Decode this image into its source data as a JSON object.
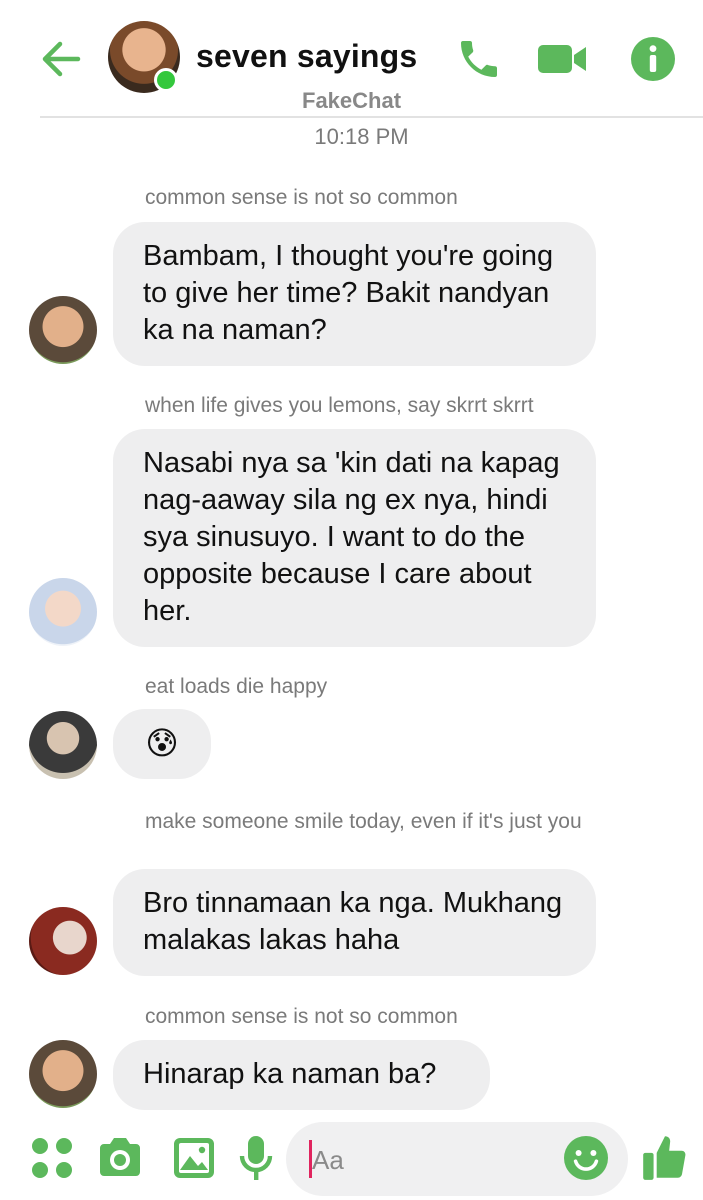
{
  "header": {
    "title": "seven sayings",
    "subtitle": "FakeChat",
    "back_icon": "arrow-left-icon",
    "actions": [
      "phone-icon",
      "video-camera-icon",
      "info-icon"
    ]
  },
  "timestamp": "10:18 PM",
  "messages": [
    {
      "sender": "common sense is not so common",
      "text": "Bambam, I thought you're going to give her time? Bakit nandyan ka na naman?"
    },
    {
      "sender": "when life gives you lemons, say skrrt skrrt",
      "text": "Nasabi nya sa 'kin dati na kapag nag-aaway sila ng ex nya, hindi sya sinusuyo. I want to do the opposite because I care about her."
    },
    {
      "sender": "eat loads die happy",
      "emoji": "😰"
    },
    {
      "sender": "make someone smile today, even if it's just you",
      "text": "Bro tinnamaan ka nga. Mukhang malakas lakas haha"
    },
    {
      "sender": "common sense is not so common",
      "text": "Hinarap ka naman ba?"
    }
  ],
  "composer": {
    "placeholder": "Aa",
    "icons": [
      "apps-grid-icon",
      "camera-icon",
      "image-icon",
      "microphone-icon",
      "emoji-icon",
      "thumbs-up-icon"
    ]
  },
  "colors": {
    "accent": "#5cb85c",
    "online": "#34c83d",
    "bubble": "#eeeeef",
    "caret": "#e0245e"
  }
}
